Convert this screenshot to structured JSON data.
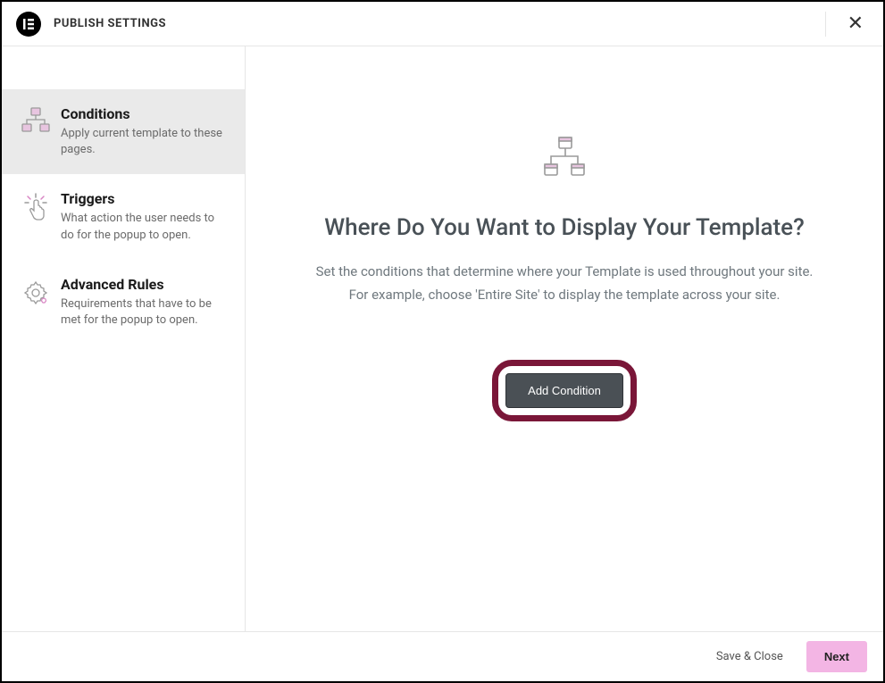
{
  "header": {
    "title": "PUBLISH SETTINGS"
  },
  "sidebar": {
    "items": [
      {
        "title": "Conditions",
        "desc": "Apply current template to these pages."
      },
      {
        "title": "Triggers",
        "desc": "What action the user needs to do for the popup to open."
      },
      {
        "title": "Advanced Rules",
        "desc": "Requirements that have to be met for the popup to open."
      }
    ]
  },
  "main": {
    "heading": "Where Do You Want to Display Your Template?",
    "desc_line1": "Set the conditions that determine where your Template is used throughout your site.",
    "desc_line2": "For example, choose 'Entire Site' to display the template across your site.",
    "add_condition_label": "Add Condition"
  },
  "footer": {
    "save_close_label": "Save & Close",
    "next_label": "Next"
  }
}
